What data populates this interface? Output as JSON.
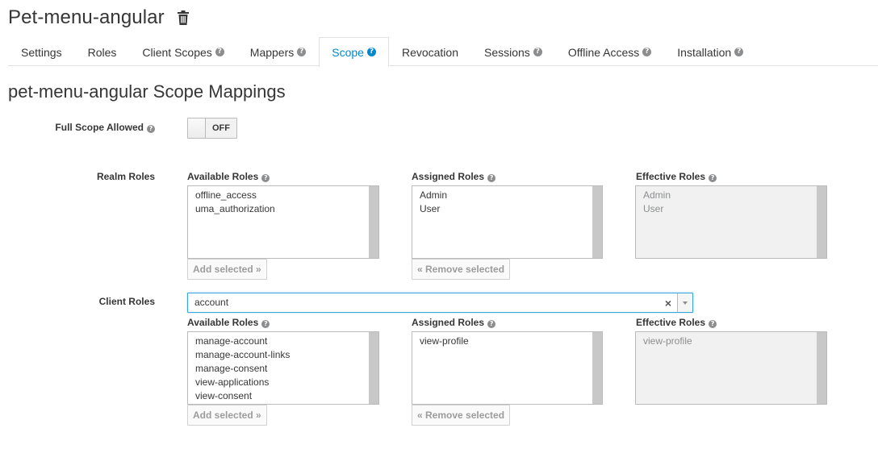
{
  "header": {
    "title": "Pet-menu-angular"
  },
  "tabs": [
    {
      "label": "Settings",
      "help": false
    },
    {
      "label": "Roles",
      "help": false
    },
    {
      "label": "Client Scopes",
      "help": true
    },
    {
      "label": "Mappers",
      "help": true
    },
    {
      "label": "Scope",
      "help": true,
      "active": true
    },
    {
      "label": "Revocation",
      "help": false
    },
    {
      "label": "Sessions",
      "help": true
    },
    {
      "label": "Offline Access",
      "help": true
    },
    {
      "label": "Installation",
      "help": true
    }
  ],
  "section": {
    "title": "pet-menu-angular Scope Mappings",
    "full_scope_label": "Full Scope Allowed",
    "full_scope_state": "OFF",
    "realm_roles_label": "Realm Roles",
    "client_roles_label": "Client Roles"
  },
  "columns": {
    "available": "Available Roles",
    "assigned": "Assigned Roles",
    "effective": "Effective Roles"
  },
  "realm": {
    "available": [
      "offline_access",
      "uma_authorization"
    ],
    "assigned": [
      "Admin",
      "User"
    ],
    "effective": [
      "Admin",
      "User"
    ]
  },
  "client": {
    "selected_client": "account",
    "clear_glyph": "×",
    "available": [
      "manage-account",
      "manage-account-links",
      "manage-consent",
      "view-applications",
      "view-consent"
    ],
    "assigned": [
      "view-profile"
    ],
    "effective": [
      "view-profile"
    ]
  },
  "buttons": {
    "add_selected": "Add selected »",
    "remove_selected": "« Remove selected"
  },
  "help_glyph": "?",
  "colors": {
    "accent": "#0088ce",
    "text": "#363636",
    "muted": "#8b8d8f"
  }
}
